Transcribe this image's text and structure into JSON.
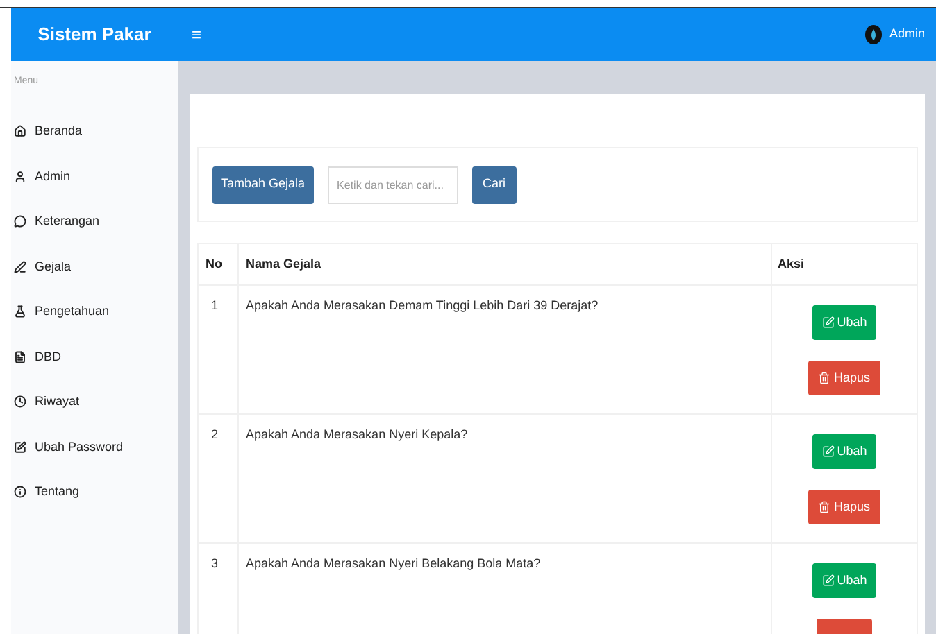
{
  "header": {
    "brand": "Sistem Pakar",
    "menu_toggle": "≡",
    "user": "Admin"
  },
  "sidebar": {
    "heading": "Menu",
    "items": [
      {
        "label": "Beranda"
      },
      {
        "label": "Admin"
      },
      {
        "label": "Keterangan"
      },
      {
        "label": "Gejala"
      },
      {
        "label": "Pengetahuan"
      },
      {
        "label": "DBD"
      },
      {
        "label": "Riwayat"
      },
      {
        "label": "Ubah Password"
      },
      {
        "label": "Tentang"
      }
    ]
  },
  "toolbar": {
    "add_button": "Tambah Gejala",
    "search": {
      "placeholder": "Ketik dan tekan cari..."
    },
    "search_button": "Cari"
  },
  "table": {
    "columns": [
      "No",
      "Nama Gejala",
      "Aksi"
    ],
    "rows": [
      {
        "no": "1",
        "name": "Apakah Anda Merasakan Demam Tinggi Lebih Dari 39 Derajat?",
        "actions": [
          {
            "kind": "edit",
            "label": "Ubah"
          },
          {
            "kind": "delete",
            "label": "Hapus"
          }
        ]
      },
      {
        "no": "2",
        "name": "Apakah Anda Merasakan Nyeri Kepala?",
        "actions": [
          {
            "kind": "edit",
            "label": "Ubah"
          },
          {
            "kind": "delete",
            "label": "Hapus"
          }
        ]
      },
      {
        "no": "3",
        "name": "Apakah Anda Merasakan Nyeri Belakang Bola Mata?",
        "actions": [
          {
            "kind": "edit",
            "label": "Ubah"
          },
          {
            "kind": "delete"
          }
        ]
      }
    ]
  }
}
